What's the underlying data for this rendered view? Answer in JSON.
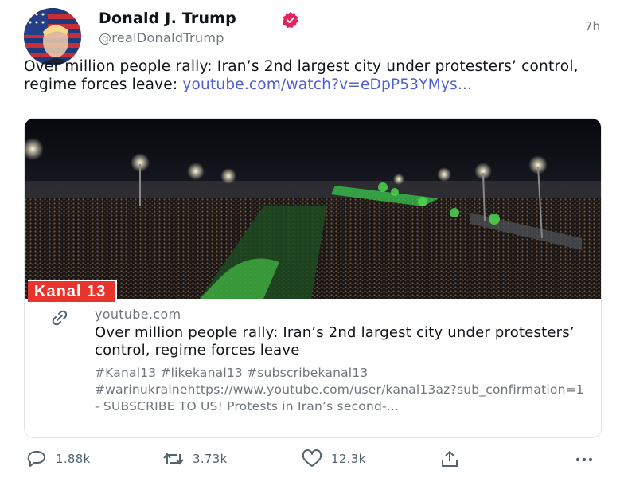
{
  "author": {
    "display_name": "Donald J. Trump",
    "handle": "@realDonaldTrump",
    "avatar_icon": "avatar-flag-portrait",
    "verified_icon": "verified-badge-icon",
    "verified_color": "#e0245e"
  },
  "tweet": {
    "time": "7h",
    "text": "Over million people rally: Iran’s 2nd largest city under protesters’ control, regime forces leave: ",
    "link_text": "youtube.com/watch?v=eDpP53YMys...",
    "link_color": "#4d5fd1"
  },
  "card": {
    "image_icon": "night-crowd-rally-photo",
    "badge": "Kanal 13",
    "badge_color": "#e8342c",
    "domain": "youtube.com",
    "title": "Over million people rally: Iran’s 2nd largest city under protesters’ control, regime forces leave",
    "description": "#Kanal13 #likekanal13 #subscribekanal13 #warinukrainehttps://www.youtube.com/user/kanal13az?sub_confirmation=1 - SUBSCRIBE TO US! Protests in Iran’s second-..."
  },
  "actions": {
    "replies": "1.88k",
    "retweets": "3.73k",
    "likes": "12.3k",
    "share_icon": "share-icon",
    "more_icon": "more-icon"
  }
}
